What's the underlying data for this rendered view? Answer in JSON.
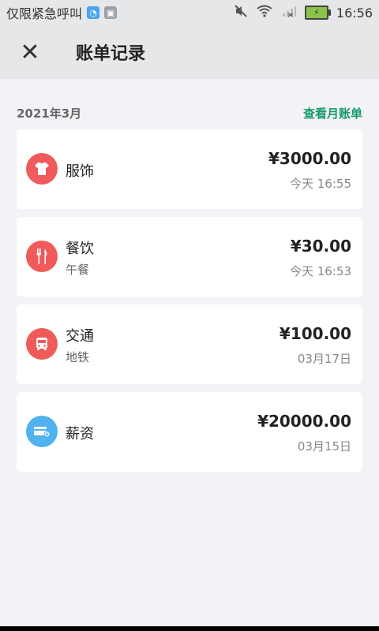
{
  "statusbar": {
    "carrier": "仅限紧急呼叫",
    "time": "16:56",
    "icons": [
      "mute-icon",
      "wifi-icon",
      "signal-icon",
      "battery-icon"
    ]
  },
  "appbar": {
    "title": "账单记录",
    "close_icon": "close-icon"
  },
  "month": {
    "label": "2021年3月",
    "view_monthly": "查看月账单"
  },
  "bills": [
    {
      "category": "服饰",
      "note": "",
      "amount": "¥3000.00",
      "time": "今天 16:55",
      "icon": "shirt-icon",
      "color": "#ef5b5b"
    },
    {
      "category": "餐饮",
      "note": "午餐",
      "amount": "¥30.00",
      "time": "今天 16:53",
      "icon": "fork-knife-icon",
      "color": "#ef5b5b"
    },
    {
      "category": "交通",
      "note": "地铁",
      "amount": "¥100.00",
      "time": "03月17日",
      "icon": "bus-icon",
      "color": "#ef5b5b"
    },
    {
      "category": "薪资",
      "note": "",
      "amount": "¥20000.00",
      "time": "03月15日",
      "icon": "salary-card-icon",
      "color": "#50b2ef"
    }
  ]
}
